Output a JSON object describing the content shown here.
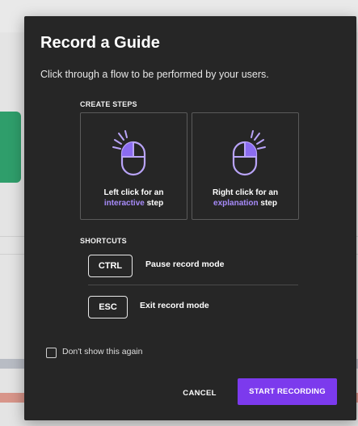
{
  "modal": {
    "title": "Record a Guide",
    "subtitle": "Click through a flow to be performed by your users."
  },
  "create_steps": {
    "label": "CREATE STEPS",
    "cards": [
      {
        "line1": "Left click for an",
        "accent": "interactive",
        "suffix": " step",
        "icon": "left-click-mouse-icon"
      },
      {
        "line1": "Right click for an",
        "accent": "explanation",
        "suffix": " step",
        "icon": "right-click-mouse-icon"
      }
    ]
  },
  "shortcuts": {
    "label": "SHORTCUTS",
    "items": [
      {
        "key": "CTRL",
        "description": "Pause record mode"
      },
      {
        "key": "ESC",
        "description": "Exit record mode"
      }
    ]
  },
  "dont_show": {
    "label": "Don't show this again",
    "checked": false
  },
  "buttons": {
    "cancel": "CANCEL",
    "start": "START RECORDING"
  },
  "colors": {
    "accent": "#a78bfa",
    "primary_button": "#7c3aed",
    "modal_bg": "#262626"
  }
}
